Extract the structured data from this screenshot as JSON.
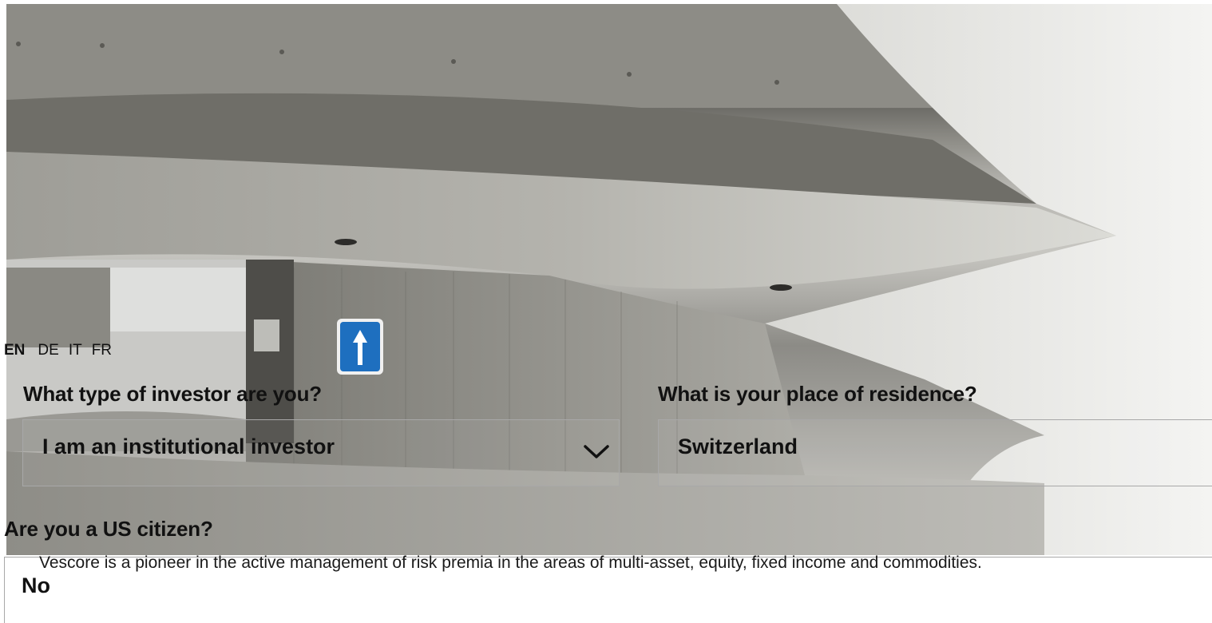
{
  "languages": {
    "items": [
      {
        "code": "EN",
        "active": true
      },
      {
        "code": "DE",
        "active": false
      },
      {
        "code": "IT",
        "active": false
      },
      {
        "code": "FR",
        "active": false
      }
    ]
  },
  "investor_type": {
    "question": "What type of investor are you?",
    "selected": "I am an institutional investor",
    "icon": "chevron-down-icon"
  },
  "residence": {
    "question": "What is your place of residence?",
    "selected": "Switzerland"
  },
  "us_citizen": {
    "question": "Are you a US citizen?",
    "selected": "No"
  },
  "about": {
    "text": "Vescore is a pioneer in the active management of risk premia in the areas of multi-asset, equity, fixed income and commodities."
  },
  "hero": {
    "sign_icon": "arrow-up-sign-icon"
  }
}
